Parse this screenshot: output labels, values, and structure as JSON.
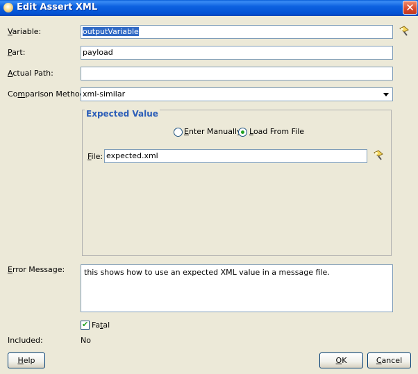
{
  "window": {
    "title": "Edit Assert XML",
    "close_glyph": "✕",
    "icon": "app-icon"
  },
  "form": {
    "variable": {
      "label_key": "V",
      "label_rest": "ariable:",
      "value": "outputVariable"
    },
    "part": {
      "label_key": "P",
      "label_rest": "art:",
      "value": "payload"
    },
    "actual_path": {
      "label_key": "A",
      "label_rest": "ctual Path:",
      "value": ""
    },
    "comparison_method": {
      "label_pre": "Co",
      "label_key": "m",
      "label_rest": "parison Method:",
      "value": "xml-similar"
    },
    "browse_icon": "flashlight-browse-icon"
  },
  "expected_value": {
    "legend": "Expected Value",
    "options": [
      {
        "pre": "",
        "key": "E",
        "rest": "nter Manually",
        "selected": false
      },
      {
        "pre": "",
        "key": "L",
        "rest": "oad From File",
        "selected": true
      }
    ],
    "file": {
      "label_key": "F",
      "label_rest": "ile:",
      "value": "expected.xml"
    }
  },
  "error_message": {
    "label_key": "E",
    "label_rest": "rror Message:",
    "value": "this shows how to use an expected XML value in a message file."
  },
  "fatal": {
    "label_pre": "Fa",
    "label_key": "t",
    "label_rest": "al",
    "checked": true,
    "check_glyph": "✔"
  },
  "included": {
    "label": "Included:",
    "value": "No"
  },
  "buttons": {
    "help": {
      "key": "H",
      "rest": "elp"
    },
    "ok": {
      "key": "O",
      "rest": "K"
    },
    "cancel": {
      "key": "C",
      "rest": "ancel"
    }
  },
  "colors": {
    "title_bar": "#0a5fd8",
    "dialog_bg": "#ece9d8",
    "legend": "#2c5eb8",
    "selection": "#316ac5"
  }
}
